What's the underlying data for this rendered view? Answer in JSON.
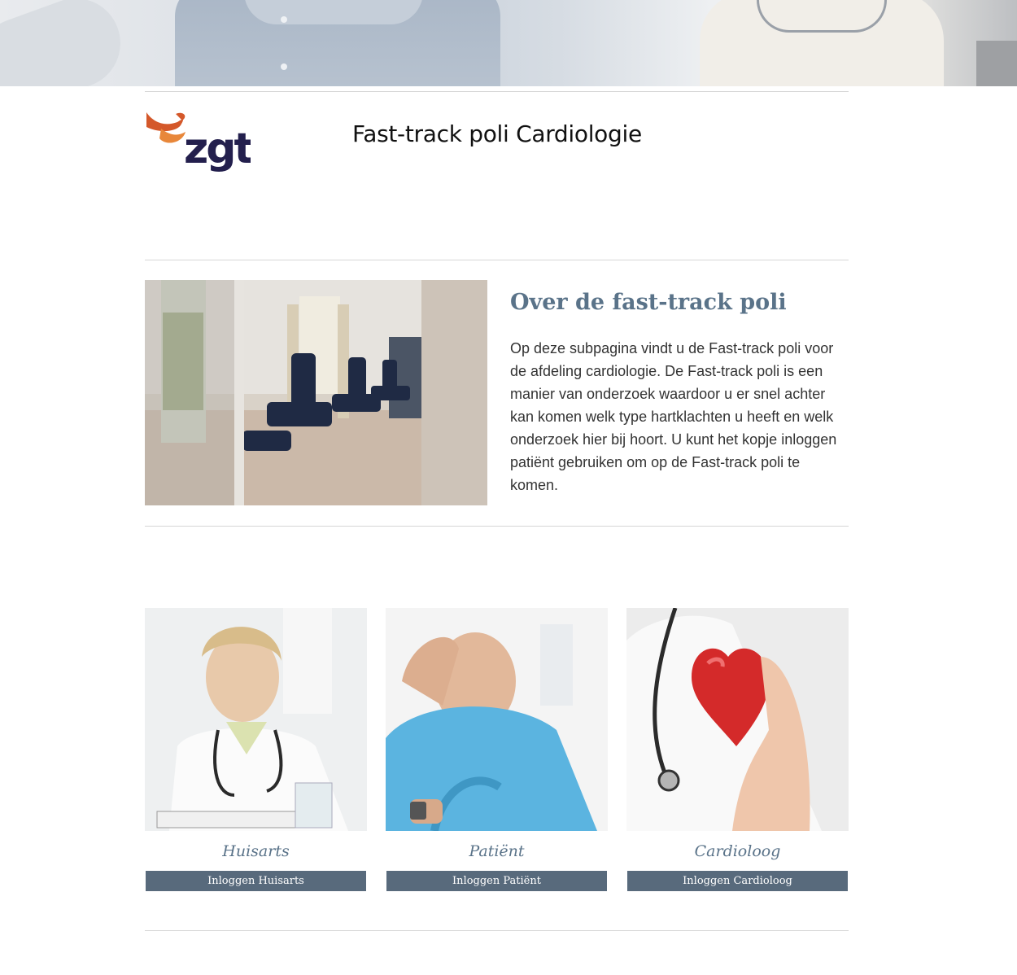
{
  "header": {
    "title": "Fast-track poli Cardiologie",
    "logo_text": "zgt"
  },
  "about": {
    "heading": "Over de fast-track poli",
    "text": "Op deze subpagina vindt u de Fast-track poli voor de afdeling cardiologie. De Fast-track poli is een manier van onderzoek waardoor u er snel achter kan komen welk type hartklachten u heeft en welk onderzoek hier bij hoort. U kunt het kopje inloggen patiënt gebruiken om op de Fast-track poli te komen."
  },
  "cards": [
    {
      "title": "Huisarts",
      "button": "Inloggen Huisarts"
    },
    {
      "title": "Patiënt",
      "button": "Inloggen Patiënt"
    },
    {
      "title": "Cardioloog",
      "button": "Inloggen Cardioloog"
    }
  ],
  "colors": {
    "accent": "#5a7389",
    "button": "#586a7c",
    "logo_orange": "#d4582a",
    "logo_navy": "#231f4d"
  }
}
